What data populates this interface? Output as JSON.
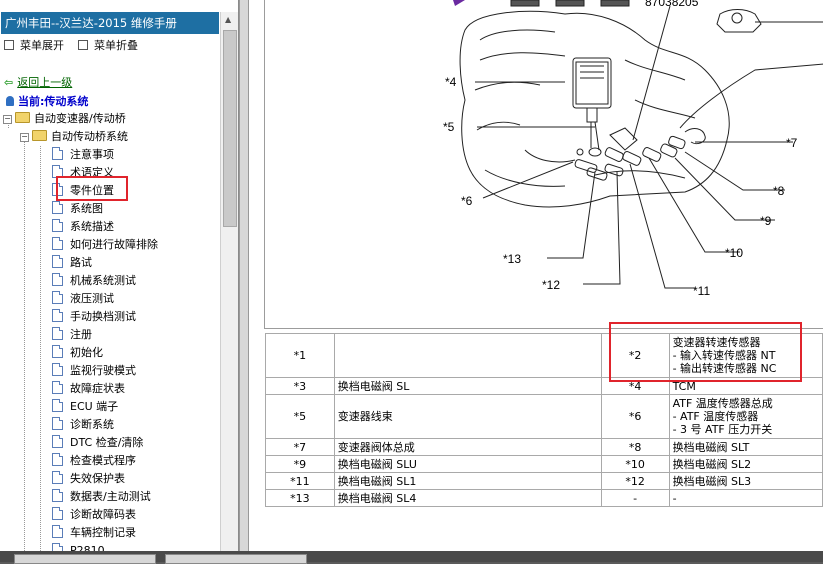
{
  "sidebar": {
    "title": "广州丰田--汉兰达-2015 维修手册",
    "expand_label": "菜单展开",
    "collapse_label": "菜单折叠",
    "back_label": "返回上一级",
    "current_label": "当前:传动系统",
    "tree": {
      "level1": "自动变速器/传动桥",
      "level2": "自动传动桥系统",
      "items": [
        "注意事项",
        "术语定义",
        "零件位置",
        "系统图",
        "系统描述",
        "如何进行故障排除",
        "路试",
        "机械系统测试",
        "液压测试",
        "手动换档测试",
        "注册",
        "初始化",
        "监视行驶模式",
        "故障症状表",
        "ECU 端子",
        "诊断系统",
        "DTC 检查/清除",
        "检查模式程序",
        "失效保护表",
        "数据表/主动测试",
        "诊断故障码表",
        "车辆控制记录",
        "P2810"
      ]
    }
  },
  "diagram": {
    "top_code": "87038205",
    "callouts": [
      "*4",
      "*5",
      "*6",
      "*7",
      "*8",
      "*9",
      "*10",
      "*11",
      "*12",
      "*13"
    ]
  },
  "parts_table": {
    "rows": [
      {
        "n1": "*1",
        "d1": "",
        "n2": "*2",
        "d2": [
          "变速器转速传感器",
          "- 输入转速传感器 NT",
          "- 输出转速传感器 NC"
        ]
      },
      {
        "n1": "*3",
        "d1": "换档电磁阀 SL",
        "n2": "*4",
        "d2": [
          "TCM"
        ]
      },
      {
        "n1": "*5",
        "d1": "变速器线束",
        "n2": "*6",
        "d2": [
          "ATF 温度传感器总成",
          "- ATF 温度传感器",
          "- 3 号 ATF 压力开关"
        ]
      },
      {
        "n1": "*7",
        "d1": "变速器阀体总成",
        "n2": "*8",
        "d2": [
          "换档电磁阀 SLT"
        ]
      },
      {
        "n1": "*9",
        "d1": "换档电磁阀 SLU",
        "n2": "*10",
        "d2": [
          "换档电磁阀 SL2"
        ]
      },
      {
        "n1": "*11",
        "d1": "换档电磁阀 SL1",
        "n2": "*12",
        "d2": [
          "换档电磁阀 SL3"
        ]
      },
      {
        "n1": "*13",
        "d1": "换档电磁阀 SL4",
        "n2": "-",
        "d2": [
          "-"
        ]
      }
    ]
  },
  "colors": {
    "title_bar": "#1e6fa3",
    "highlight": "#e0242c",
    "link_green": "#006400",
    "current_blue": "#0000cc"
  }
}
